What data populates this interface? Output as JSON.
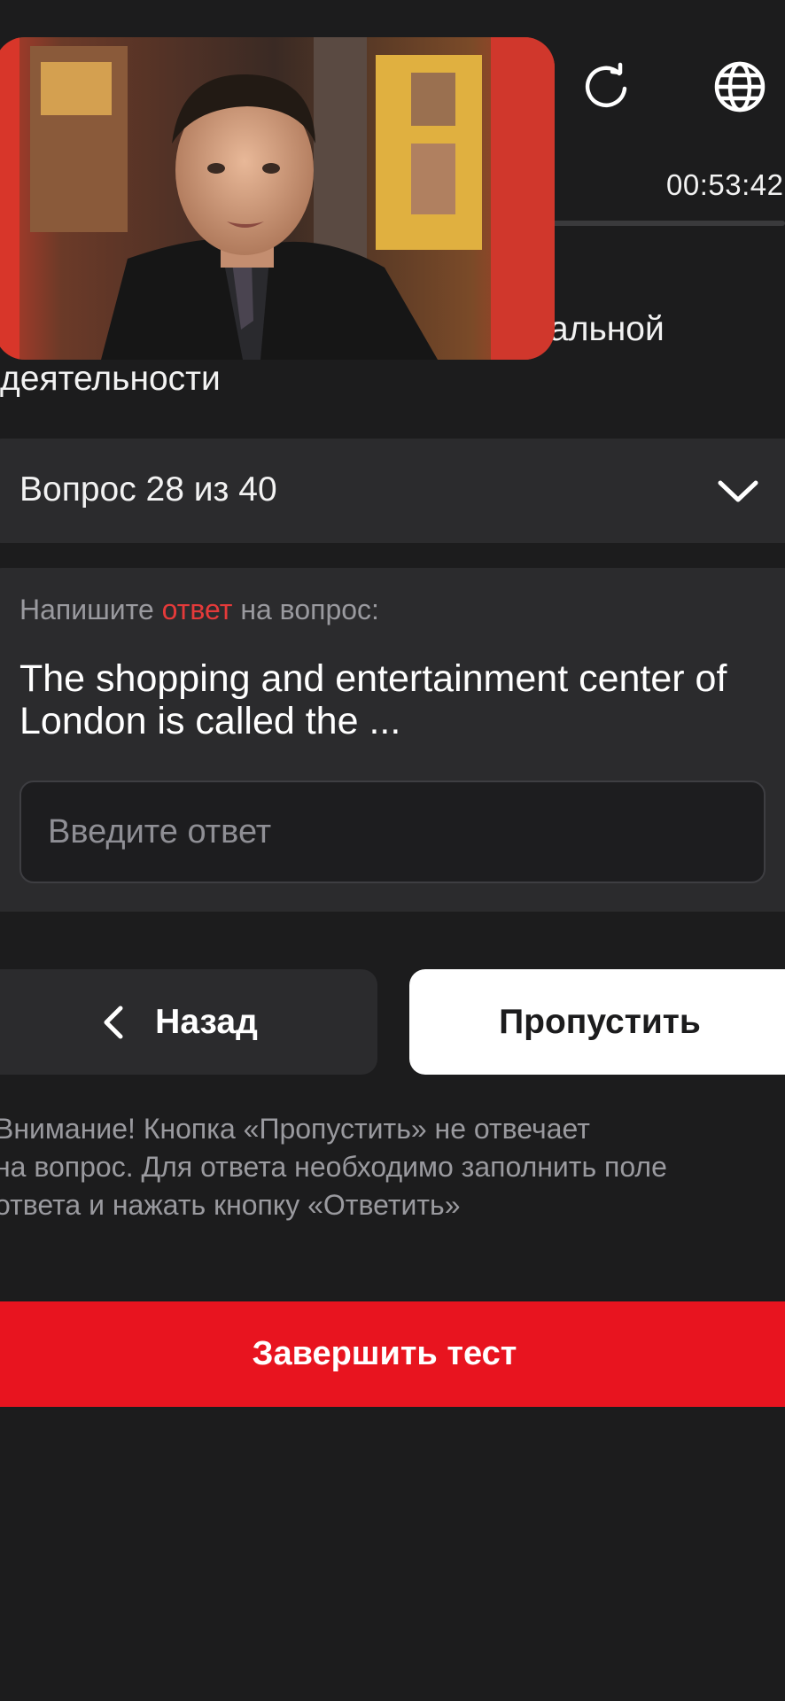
{
  "header": {
    "timer": "00:53:42",
    "refresh_icon": "refresh-icon",
    "language_icon": "globe-icon"
  },
  "subject": {
    "line1": "альной",
    "line2": "деятельности"
  },
  "video": {
    "description_icon": "video-thumbnail"
  },
  "question_selector": {
    "label": "Вопрос 28 из 40",
    "icon": "chevron-down-icon"
  },
  "question_card": {
    "prompt_before": "Напишите ",
    "prompt_accent": "ответ",
    "prompt_after": " на вопрос:",
    "question_text": "The shopping and entertainment center of London is called the ...",
    "answer_placeholder": "Введите ответ",
    "answer_value": ""
  },
  "navigation": {
    "back_label": "Назад",
    "skip_label": "Пропустить"
  },
  "warning": {
    "line1": "Внимание! Кнопка «Пропустить» не отвечает",
    "line2": "на вопрос. Для ответа необходимо заполнить поле",
    "line3": "ответа и нажать кнопку «Ответить»"
  },
  "finish": {
    "label": "Завершить тест"
  },
  "colors": {
    "background": "#1c1c1d",
    "card": "#2b2b2d",
    "accent_red": "#e8141f",
    "prompt_accent": "#e53a3a"
  }
}
